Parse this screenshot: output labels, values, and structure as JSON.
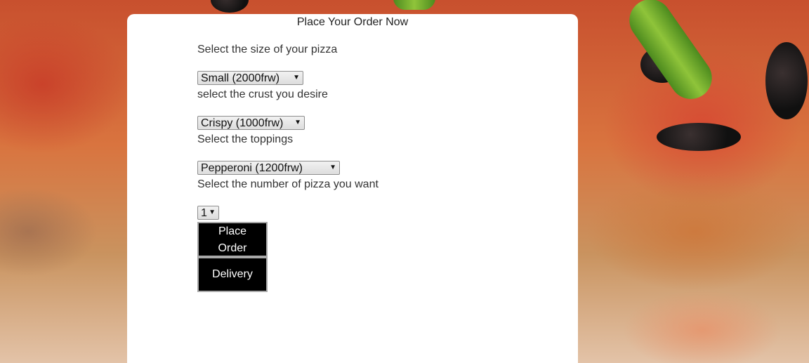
{
  "form": {
    "title": "Place Your Order Now",
    "size": {
      "label": "Select the size of your pizza",
      "selected": "Small (2000frw)"
    },
    "crust": {
      "label": "select the crust you desire",
      "selected": "Crispy (1000frw)"
    },
    "toppings": {
      "label": "Select the toppings",
      "selected": "Pepperoni (1200frw)"
    },
    "quantity": {
      "label": "Select the number of pizza you want",
      "selected": "1"
    },
    "buttons": {
      "place_order": "Place Order",
      "delivery": "Delivery"
    }
  },
  "icons": {
    "dropdown": "chevron-down-icon"
  },
  "colors": {
    "card_background": "#ffffff",
    "button_background": "#000000",
    "button_text": "#ffffff"
  }
}
